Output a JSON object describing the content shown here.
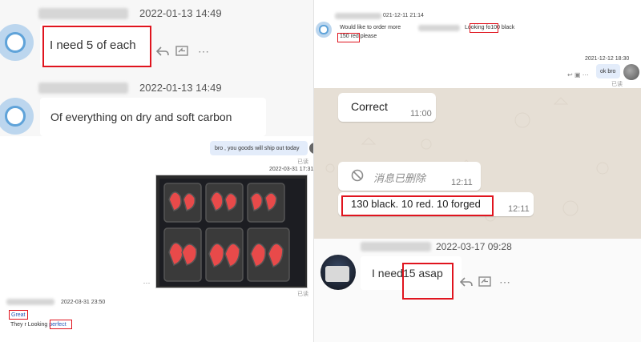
{
  "top_left": {
    "msg1": {
      "timestamp": "2022-01-13 14:49",
      "text": "I need 5 of each"
    },
    "msg2": {
      "timestamp": "2022-01-13 14:49",
      "text": "Of everything on dry and soft carbon"
    }
  },
  "bottom_left": {
    "outgoing_text": "bro , you goods will ship out today",
    "read1": "已读",
    "photo_time": "2022-03-31 17:31",
    "read2": "已读",
    "incoming_time": "2022-03-31 23:50",
    "reply1": "Great",
    "reply2_prefix": "They r Looking ",
    "reply2_highlight": "perfect"
  },
  "top_right": {
    "incoming_time": "021-12-11 21:14",
    "msg_prefix": "Would like to order more",
    "msg_mid": "Looking fo",
    "msg_highlight1": "100 black",
    "msg_line2_highlight": "150 red",
    "msg_line2_suffix": " please",
    "outgoing_time": "2021-12-12 18:30",
    "outgoing_text": "ok bro",
    "read": "已读"
  },
  "whatsapp": {
    "msg1": {
      "text": "Correct",
      "time": "11:00"
    },
    "msg2": {
      "text": "消息已删除",
      "time": "12:11"
    },
    "msg3": {
      "text": "130 black. 10 red. 10 forged",
      "time": "12:11"
    }
  },
  "bottom_right": {
    "timestamp": "2022-03-17 09:28",
    "text_prefix": "I need ",
    "text_highlight": "15 asap"
  },
  "icons": [
    "reply-icon",
    "forward-icon",
    "more-icon",
    "deleted-icon",
    "avatar"
  ]
}
